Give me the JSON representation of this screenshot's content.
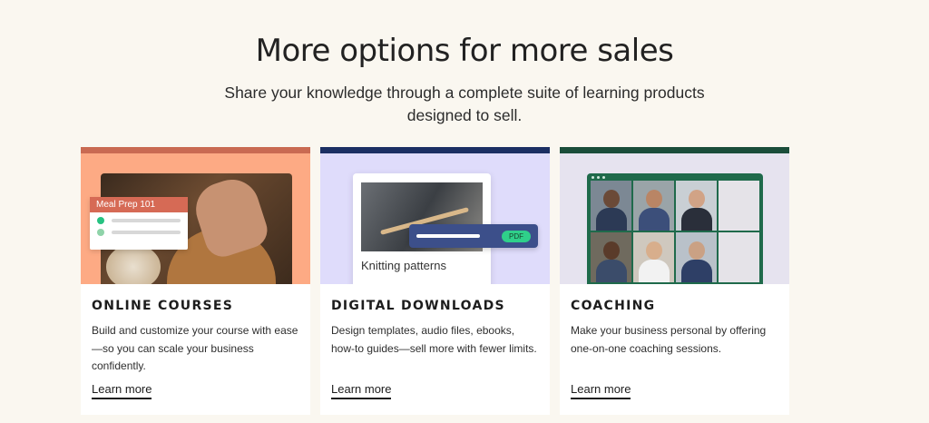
{
  "hero": {
    "title": "More options for more sales",
    "subtitle": "Share your knowledge through a complete suite of learning products designed to sell."
  },
  "cards": [
    {
      "accent": "#c96a52",
      "title": "ONLINE COURSES",
      "description": "Build and customize your course with ease—so you can scale your business confidently.",
      "link": "Learn more",
      "media": {
        "panel_label": "Meal Prep 101"
      }
    },
    {
      "accent": "#1b2f63",
      "title": "DIGITAL DOWNLOADS",
      "description": "Design templates, audio files, ebooks, how-to guides—sell more with fewer limits.",
      "link": "Learn more",
      "media": {
        "sheet_label": "Knitting patterns",
        "badge": "PDF"
      }
    },
    {
      "accent": "#1a4d3a",
      "title": "COACHING",
      "description": "Make your business personal by offering one-on-one coaching sessions.",
      "link": "Learn more",
      "media": {}
    }
  ],
  "colors": {
    "page_background": "#faf7f0",
    "card1_media": "#fdaa84",
    "card2_media": "#dfdcfb",
    "card3_media": "#e6e3ef",
    "pdf_badge": "#2fd08a"
  }
}
